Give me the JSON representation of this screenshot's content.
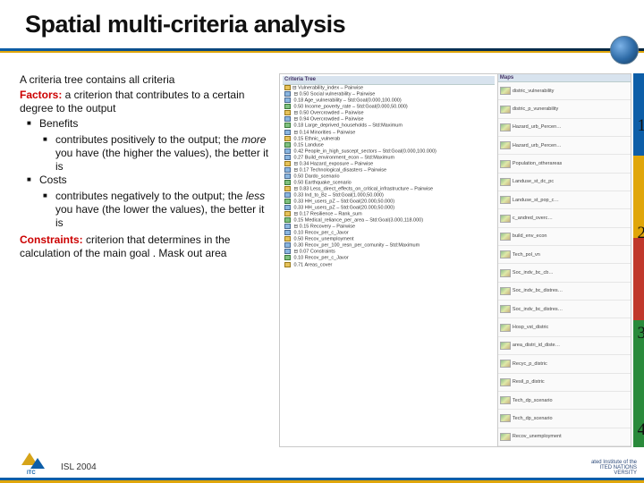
{
  "title": "Spatial multi-criteria analysis",
  "left": {
    "intro": "A criteria tree contains all criteria",
    "factors_label": "Factors:",
    "factors_desc": " a criterion that contributes to a certain degree to the output",
    "benefits": "Benefits",
    "benefits_sub_a": "contributes positively to the output; the ",
    "benefits_sub_more": "more",
    "benefits_sub_b": " you have (the higher the values), the better it is",
    "costs": "Costs",
    "costs_sub_a": "contributes negatively to the output; the ",
    "costs_sub_less": "less",
    "costs_sub_b": " you have (the lower the values), the better it is",
    "constraints_label": "Constraints:",
    "constraints_desc": " criterion that determines in the calculation of the main goal . Mask out area"
  },
  "tree": {
    "header": "Criteria Tree",
    "root": "Vulnerability_index",
    "rows": [
      "⊟ Vulnerability_index – Pairwise",
      "  ⊟ 0.50 Social vulnerability – Pairwise",
      "    0.18 Age_vulnerability – Std:Goal(0.000,100.000)",
      "    0.50 Income_poverty_rate – Std:Goal(0.000,50.000)",
      "  ⊟ 0.50 Overcrowded – Pairwise",
      "    ⊟ 0.94 Overcrowded – Pairwise",
      "      0.18 Large_deprived_households – Std:Maximum",
      "  ⊟ 0.14 Minorities – Pairwise",
      "    0.15 Ethnic_vulnerab",
      "    0.15 Landuse",
      "    0.42 People_in_high_suscept_sectors – Std:Goal(0.000,100.000)",
      "    0.27 Build_environment_econ – Std:Maximum",
      "  ⊟ 0.34 Hazard_exposure – Pairwise",
      "    ⊟ 0.17 Technological_disasters – Pairwise",
      "      0.50 Dardo_scenario",
      "      0.50 Earthquake_scenario",
      "  ⊟ 0.83 Less_direct_effects_on_critical_infrastructure – Pairwise",
      "    0.33 Ind_to_Bz – Std:Goal(1.000,50.000)",
      "    0.33 HH_users_pZ – Std:Goal(20.000,50.000)",
      "    0.33 HH_users_pZ – Std:Goal(20.000,50.000)",
      "  ⊟ 0.17 Resilience – Rank_sum",
      "    0.15 Medical_reliance_per_area – Std:Goal(3.000,118.000)",
      "    ⊟ 0.15 Recovery – Pairwise",
      "      0.10 Recov_per_c_Javor",
      "      0.50 Recov_unemployment",
      "      0.30 Recov_per_100_resn_per_comunity – Std:Maximum",
      "  ⊟ 0.07 Constraints",
      "    0.10 Recov_per_c_Javor",
      "    0.71 Areas_cover"
    ]
  },
  "maps": {
    "header": "Maps",
    "items": [
      "distric_vulnerability",
      "distric_p_vunerability",
      "Hazard_urb_Percen…",
      "Hazard_urb_Percen…",
      "Population_otherareas",
      "Landuse_st_dc_pc",
      "Landuse_st_pop_c…",
      "c_andred_overc…",
      "build_env_econ",
      "Tech_pol_vn",
      "Soc_indv_bc_cb…",
      "Soc_indv_bc_distres…",
      "Soc_indv_bc_distres…",
      "Hosp_vst_distric",
      "area_distri_id_diste…",
      "Recyc_p_distric",
      "Resil_p_distric",
      "Tech_dp_scenario",
      "Tech_dp_scenario",
      "Recov_unemployment"
    ]
  },
  "numbers": [
    "1",
    "2",
    "3",
    "4"
  ],
  "footer": {
    "note": "ISL 2004",
    "logo": "ITC",
    "unu1": "ated Institute of the",
    "unu2": "ITED NATIONS",
    "unu3": "VERSITY"
  }
}
